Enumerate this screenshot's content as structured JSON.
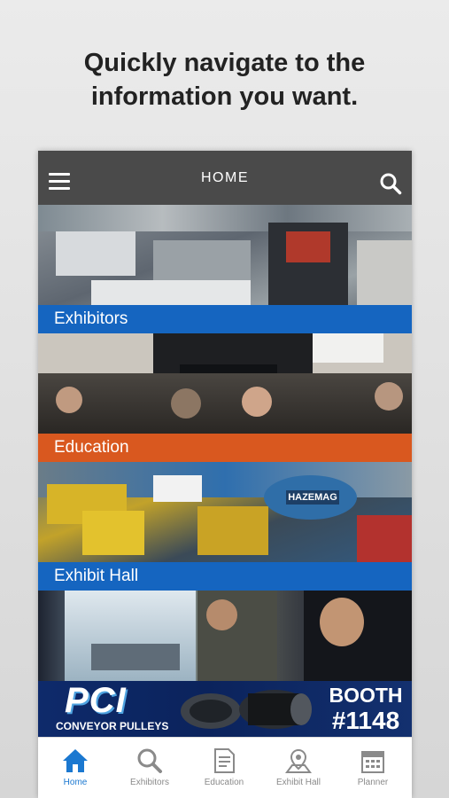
{
  "headline": {
    "line1": "Quickly navigate to the",
    "line2": "information you want."
  },
  "header": {
    "title": "HOME",
    "menu_icon": "hamburger-menu-icon",
    "search_icon": "search-icon",
    "background": "#4a4a4a"
  },
  "tiles": [
    {
      "label": "Exhibitors",
      "color": "#1565c0"
    },
    {
      "label": "Education",
      "color": "#d9581f"
    },
    {
      "label": "Exhibit Hall",
      "color": "#1565c0"
    },
    {
      "label": ""
    }
  ],
  "ad": {
    "brand": "PCI",
    "tagline": "CONVEYOR PULLEYS",
    "booth_label": "BOOTH",
    "booth_number": "#1148"
  },
  "tabbar": {
    "active": "Home",
    "active_color": "#1b78d0",
    "items": [
      {
        "label": "Home",
        "icon": "home-icon"
      },
      {
        "label": "Exhibitors",
        "icon": "search-icon"
      },
      {
        "label": "Education",
        "icon": "document-icon"
      },
      {
        "label": "Exhibit Hall",
        "icon": "map-pin-icon"
      },
      {
        "label": "Planner",
        "icon": "calendar-icon"
      }
    ]
  }
}
